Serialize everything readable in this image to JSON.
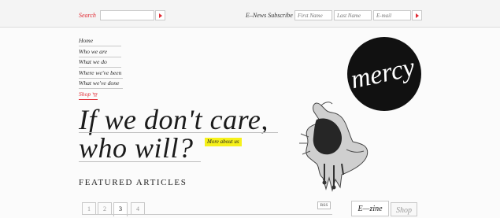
{
  "header": {
    "search_label": "Search",
    "enews_label": "E–News Subscribe",
    "first_name_placeholder": "First Name",
    "last_name_placeholder": "Last Name",
    "email_placeholder": "E-mail"
  },
  "nav": {
    "items": [
      "Home",
      "Who we are",
      "What we do",
      "Where we've been",
      "What we've done",
      "Shop"
    ]
  },
  "logo": {
    "text": "mercy"
  },
  "hero": {
    "line1": "If we don't care,",
    "line2": "who will?",
    "more_link": "More about us"
  },
  "featured": {
    "heading": "FEATURED ARTICLES",
    "pages": [
      "1",
      "2",
      "3",
      "4"
    ],
    "active_page": "3",
    "rss": "RSS"
  },
  "sidebar": {
    "tabs": [
      "E—zine",
      "Shop"
    ]
  },
  "colors": {
    "accent": "#e12b34",
    "highlight": "#f6f11a",
    "logo_bg": "#111111"
  }
}
